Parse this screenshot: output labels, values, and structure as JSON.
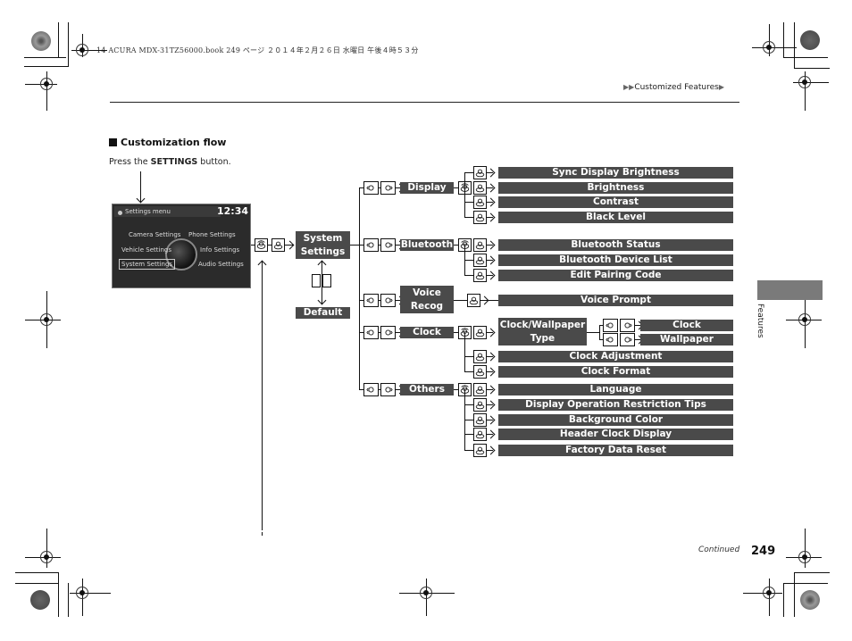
{
  "print_header": "14 ACURA MDX-31TZ56000.book  249 ページ  ２０１４年２月２６日  水曜日  午後４時５３分",
  "breadcrumb": {
    "prefix": "▶▶",
    "label": "Customized Features",
    "suffix": "▶"
  },
  "section_title": "Customization flow",
  "instruction": {
    "before": "Press the ",
    "bold": "SETTINGS",
    "after": " button."
  },
  "screen": {
    "title": "Settings menu",
    "time": "12:34",
    "options": [
      "Camera Settings",
      "Phone Settings",
      "Vehicle Settings",
      "Info Settings",
      "System Settings",
      "Audio Settings"
    ],
    "selected": "System Settings"
  },
  "flow": {
    "root": "System Settings",
    "root_line1": "System",
    "root_line2": "Settings",
    "default": "Default",
    "categories": [
      {
        "label": "Display",
        "items": [
          "Sync Display Brightness",
          "Brightness",
          "Contrast",
          "Black Level"
        ]
      },
      {
        "label": "Bluetooth",
        "items": [
          "Bluetooth Status",
          "Bluetooth Device List",
          "Edit Pairing Code"
        ]
      },
      {
        "label": "Voice Recog",
        "line1": "Voice",
        "line2": "Recog",
        "items": [
          "Voice Prompt"
        ]
      },
      {
        "label": "Clock",
        "items": [
          "Clock/Wallpaper Type",
          "Clock Adjustment",
          "Clock Format"
        ],
        "sub_line1": "Clock/Wallpaper",
        "sub_line2": "Type",
        "sub_items": [
          "Clock",
          "Wallpaper"
        ]
      },
      {
        "label": "Others",
        "items": [
          "Language",
          "Display Operation Restriction Tips",
          "Background Color",
          "Header Clock Display",
          "Factory Data Reset"
        ]
      }
    ]
  },
  "icons": {
    "knob_press": "interface-dial-press-icon",
    "knob_rotate": "interface-dial-rotate-icon",
    "knob_move": "interface-dial-move-icon"
  },
  "side_tab": "Features",
  "footer": {
    "continued": "Continued",
    "page": "249"
  },
  "colors": {
    "box": "#4a4a4a",
    "tab": "#7a7a7a",
    "text": "#222222"
  }
}
